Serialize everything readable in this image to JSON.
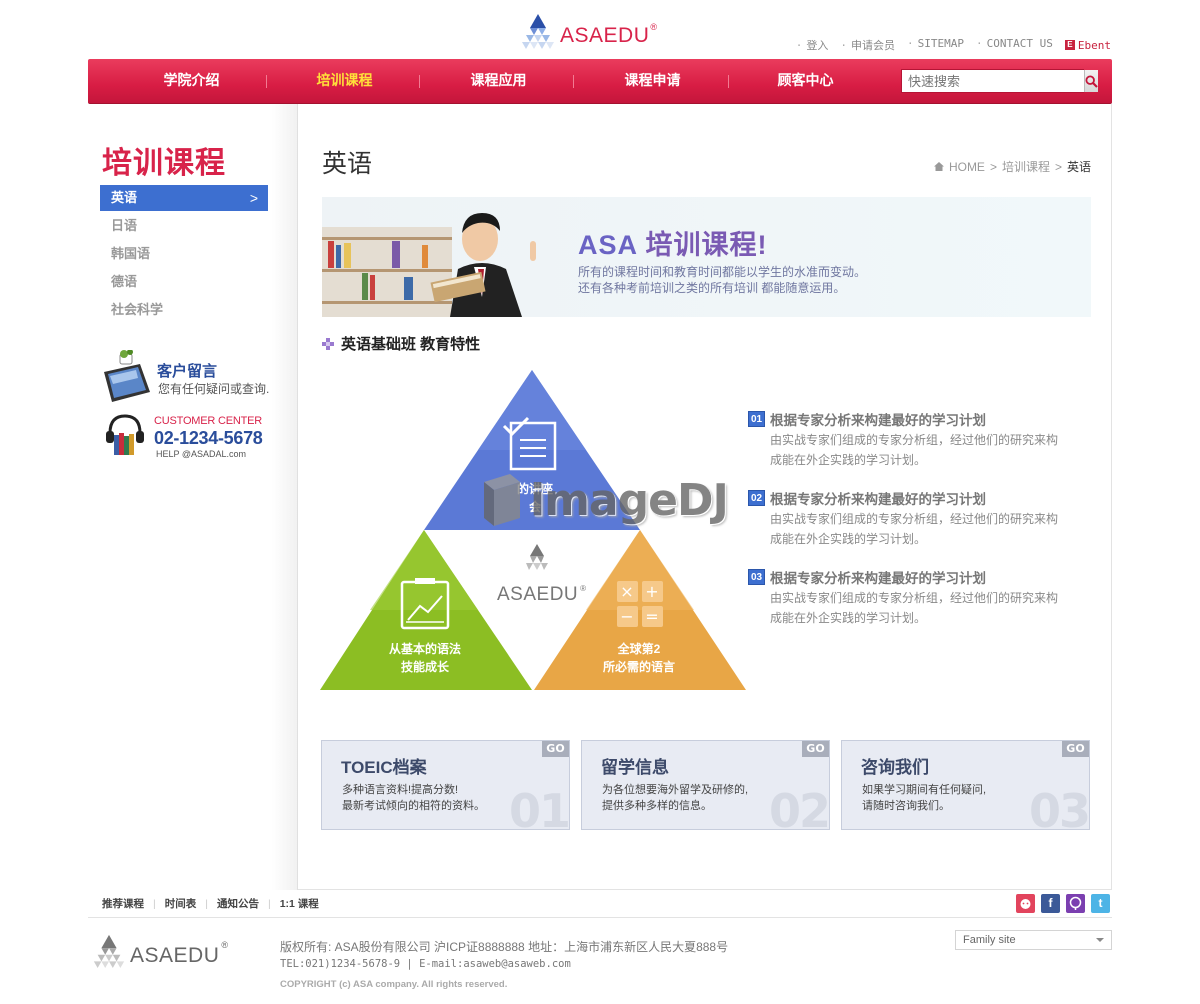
{
  "header": {
    "logo_text": "ASAEDU",
    "logo_mark": "®",
    "top_links": [
      "登入",
      "申请会员",
      "SITEMAP",
      "CONTACT US"
    ],
    "ebent_label": "Ebent",
    "ebent_icon": "E"
  },
  "nav": {
    "items": [
      "学院介绍",
      "培训课程",
      "课程应用",
      "课程申请",
      "顾客中心"
    ],
    "active_index": 1,
    "search_placeholder": "快速搜索"
  },
  "sidebar": {
    "title": "培训课程",
    "menu": [
      "英语",
      "日语",
      "韩国语",
      "德语",
      "社会科学"
    ],
    "active_chevron": ">",
    "message": {
      "title": "客户留言",
      "desc": "您有任何疑问或查询."
    },
    "customer_center": {
      "label": "CUSTOMER CENTER",
      "phone": "02-1234-5678",
      "email": "HELP @ASADAL.com"
    }
  },
  "content": {
    "page_title": "英语",
    "breadcrumb": [
      "HOME",
      "培训课程",
      "英语"
    ],
    "banner": {
      "title_brand": "ASA",
      "title_rest": " 培训课程!",
      "desc_line1": "所有的课程时间和教育时间都能以学生的水准而变动。",
      "desc_line2": "还有各种考前培训之类的所有培训 都能随意运用。"
    },
    "section_title": "英语基础班 教育特性",
    "pyramid": {
      "top_line1": "的讲座",
      "top_line2": "会",
      "left_line1": "从基本的语法",
      "left_line2": "技能成长",
      "right_line1": "全球第2",
      "right_line2": "所必需的语言",
      "center_logo": "ASAEDU",
      "center_mark": "®"
    },
    "features": [
      {
        "num": "01",
        "title": "根据专家分析来构建最好的学习计划",
        "desc": "由实战专家们组成的专家分析组，经过他们的研究来构成能在外企实践的学习计划。"
      },
      {
        "num": "02",
        "title": "根据专家分析来构建最好的学习计划",
        "desc": "由实战专家们组成的专家分析组，经过他们的研究来构成能在外企实践的学习计划。"
      },
      {
        "num": "03",
        "title": "根据专家分析来构建最好的学习计划",
        "desc": "由实战专家们组成的专家分析组，经过他们的研究来构成能在外企实践的学习计划。"
      }
    ],
    "cards": [
      {
        "title": "TOEIC档案",
        "line1": "多种语言资料!提高分数!",
        "line2": "最新考试倾向的相符的资料。",
        "num": "01",
        "go": "GO"
      },
      {
        "title": "留学信息",
        "line1": "为各位想要海外留学及研修的,",
        "line2": "提供多种多样的信息。",
        "num": "02",
        "go": "GO"
      },
      {
        "title": "咨询我们",
        "line1": "如果学习期间有任何疑问,",
        "line2": "请随时咨询我们。",
        "num": "03",
        "go": "GO"
      }
    ]
  },
  "watermark": "imageDJ",
  "footer": {
    "links": [
      "推荐课程",
      "时间表",
      "通知公告",
      "1:1 课程"
    ],
    "social_icons": [
      "f",
      "t"
    ],
    "logo_text": "ASAEDU",
    "logo_mark": "®",
    "info_line1": "版权所有: ASA股份有限公司 沪ICP证8888888 地址：上海市浦东新区人民大夏888号",
    "info_line2": "TEL:021)1234-5678-9 | E-mail:asaweb@asaweb.com",
    "copyright": "COPYRIGHT (c) ASA company. All rights reserved.",
    "family_site": "Family site"
  },
  "colors": {
    "brand": "#d8234a",
    "nav": "#d81d44",
    "accent_blue": "#3d6fd0",
    "pyramid_blue": "#5b79d6",
    "pyramid_green": "#8cbe23",
    "pyramid_orange": "#e8a646"
  }
}
